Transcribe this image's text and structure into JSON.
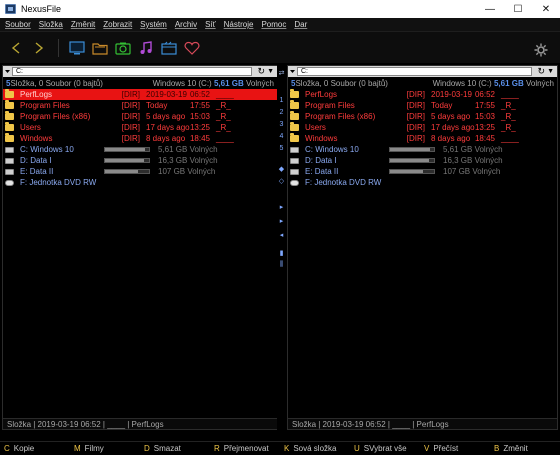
{
  "window": {
    "title": "NexusFile",
    "minimize": "—",
    "maximize": "☐",
    "close": "✕"
  },
  "menu": [
    "Soubor",
    "Složka",
    "Změnit",
    "Zobrazit",
    "Systém",
    "Archiv",
    "Síť",
    "Nástroje",
    "Pomoc",
    "Dar"
  ],
  "toolbar": {
    "buttons": [
      {
        "icon": "back-arrow-icon",
        "color": "#b9a633"
      },
      {
        "icon": "forward-arrow-icon",
        "color": "#b9a633"
      },
      {
        "icon": "monitor-icon",
        "color": "#3b8ed8"
      },
      {
        "icon": "folder-icon",
        "color": "#c98a2a"
      },
      {
        "icon": "camera-icon",
        "color": "#34c134"
      },
      {
        "icon": "music-icon",
        "color": "#b14cd6"
      },
      {
        "icon": "film-icon",
        "color": "#3b8ed8"
      },
      {
        "icon": "heart-icon",
        "color": "#d84a5a"
      },
      {
        "icon": "gear-icon",
        "color": "#9a9a9a"
      }
    ]
  },
  "panels": {
    "left": {
      "path": "C:",
      "count_value": "5",
      "count_text": " Složka, 0 Soubor (0 bajtů)",
      "drive_label": "Windows 10 (C:) ",
      "drive_free": "5,61 GB",
      "drive_suffix": " Volných",
      "files": [
        {
          "name": "PerfLogs",
          "type": "[DIR]",
          "date": "2019-03-19",
          "time": "06:52",
          "attr": "____"
        },
        {
          "name": "Program Files",
          "type": "[DIR]",
          "date": "Today",
          "time": "17:55",
          "attr": "_R_"
        },
        {
          "name": "Program Files (x86)",
          "type": "[DIR]",
          "date": "5 days ago",
          "time": "15:03",
          "attr": "_R_"
        },
        {
          "name": "Users",
          "type": "[DIR]",
          "date": "17 days ago",
          "time": "13:25",
          "attr": "_R_"
        },
        {
          "name": "Windows",
          "type": "[DIR]",
          "date": "8 days ago",
          "time": "18:45",
          "attr": "____"
        }
      ],
      "drives": [
        {
          "name": "C: Windows 10",
          "free": "5,61 GB Volných",
          "fill": 0.9
        },
        {
          "name": "D: Data I",
          "free": "16,3 GB Volných",
          "fill": 0.88
        },
        {
          "name": "E: Data II",
          "free": "107 GB Volných",
          "fill": 0.75
        },
        {
          "name": "F: Jednotka DVD RW",
          "free": "",
          "fill": null
        }
      ],
      "status": "Složka  |  2019-03-19 06:52  |  ____  |  PerfLogs"
    },
    "right": {
      "path": "C:",
      "count_value": "5",
      "count_text": " Složka, 0 Soubor (0 bajtů)",
      "drive_label": "Windows 10 (C:) ",
      "drive_free": "5,61 GB",
      "drive_suffix": " Volných",
      "files": [
        {
          "name": "PerfLogs",
          "type": "[DIR]",
          "date": "2019-03-19",
          "time": "06:52",
          "attr": "____"
        },
        {
          "name": "Program Files",
          "type": "[DIR]",
          "date": "Today",
          "time": "17:55",
          "attr": "_R_"
        },
        {
          "name": "Program Files (x86)",
          "type": "[DIR]",
          "date": "5 days ago",
          "time": "15:03",
          "attr": "_R_"
        },
        {
          "name": "Users",
          "type": "[DIR]",
          "date": "17 days ago",
          "time": "13:25",
          "attr": "_R_"
        },
        {
          "name": "Windows",
          "type": "[DIR]",
          "date": "8 days ago",
          "time": "18:45",
          "attr": "____"
        }
      ],
      "drives": [
        {
          "name": "C: Windows 10",
          "free": "5,61 GB Volných",
          "fill": 0.9
        },
        {
          "name": "D: Data I",
          "free": "16,3 GB Volných",
          "fill": 0.88
        },
        {
          "name": "E: Data II",
          "free": "107 GB Volných",
          "fill": 0.75
        },
        {
          "name": "F: Jednotka DVD RW",
          "free": "",
          "fill": null
        }
      ],
      "status": "Složka  |  2019-03-19 06:52  |  ____  |  PerfLogs"
    }
  },
  "middle": {
    "arrows_top": "⇄",
    "numbers": [
      "1",
      "2",
      "3",
      "4",
      "5"
    ],
    "symbols": [
      "◆",
      "◇"
    ],
    "arrows": [
      "▸",
      "▸",
      "◂"
    ],
    "tail": [
      "▮",
      "⫼"
    ]
  },
  "fkeys": [
    {
      "key": "C",
      "label": "Kopie"
    },
    {
      "key": "M",
      "label": "Filmy"
    },
    {
      "key": "D",
      "label": "Smazat"
    },
    {
      "key": "R",
      "label": "Přejmenovat"
    },
    {
      "key": "K",
      "label": "Sová složka"
    },
    {
      "key": "U",
      "label": "SVybrat vše"
    },
    {
      "key": "V",
      "label": "Přečíst"
    },
    {
      "key": "B",
      "label": "Změnit"
    }
  ]
}
